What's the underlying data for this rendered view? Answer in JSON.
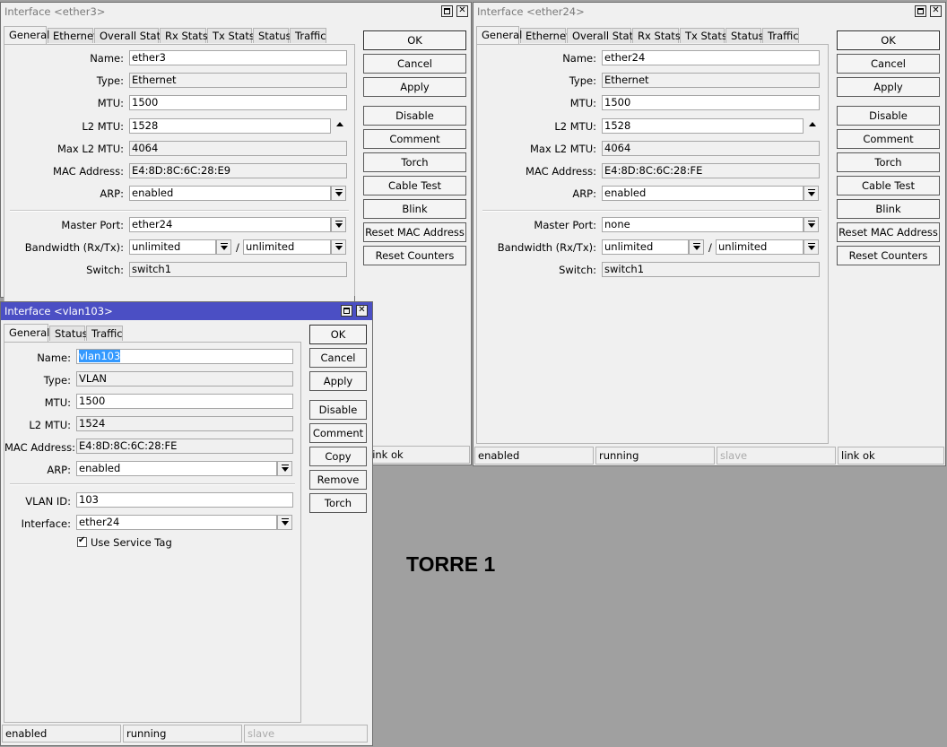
{
  "caption": "TORRE 1",
  "window_ether3": {
    "title": "Interface <ether3>",
    "tabs": [
      "General",
      "Ethernet",
      "Overall Stats",
      "Rx Stats",
      "Tx Stats",
      "Status",
      "Traffic"
    ],
    "fields": {
      "name_label": "Name:",
      "name": "ether3",
      "type_label": "Type:",
      "type": "Ethernet",
      "mtu_label": "MTU:",
      "mtu": "1500",
      "l2mtu_label": "L2 MTU:",
      "l2mtu": "1528",
      "maxl2mtu_label": "Max L2 MTU:",
      "maxl2mtu": "4064",
      "mac_label": "MAC Address:",
      "mac": "E4:8D:8C:6C:28:E9",
      "arp_label": "ARP:",
      "arp": "enabled",
      "master_label": "Master Port:",
      "master": "ether24",
      "bw_label": "Bandwidth (Rx/Tx):",
      "bw_rx": "unlimited",
      "bw_tx": "unlimited",
      "bw_sep": "/",
      "switch_label": "Switch:",
      "switch": "switch1"
    },
    "buttons": [
      "OK",
      "Cancel",
      "Apply",
      "Disable",
      "Comment",
      "Torch",
      "Cable Test",
      "Blink",
      "Reset MAC Address",
      "Reset Counters"
    ],
    "status": [
      "link ok"
    ]
  },
  "window_ether24": {
    "title": "Interface <ether24>",
    "tabs": [
      "General",
      "Ethernet",
      "Overall Stats",
      "Rx Stats",
      "Tx Stats",
      "Status",
      "Traffic"
    ],
    "fields": {
      "name_label": "Name:",
      "name": "ether24",
      "type_label": "Type:",
      "type": "Ethernet",
      "mtu_label": "MTU:",
      "mtu": "1500",
      "l2mtu_label": "L2 MTU:",
      "l2mtu": "1528",
      "maxl2mtu_label": "Max L2 MTU:",
      "maxl2mtu": "4064",
      "mac_label": "MAC Address:",
      "mac": "E4:8D:8C:6C:28:FE",
      "arp_label": "ARP:",
      "arp": "enabled",
      "master_label": "Master Port:",
      "master": "none",
      "bw_label": "Bandwidth (Rx/Tx):",
      "bw_rx": "unlimited",
      "bw_tx": "unlimited",
      "bw_sep": "/",
      "switch_label": "Switch:",
      "switch": "switch1"
    },
    "buttons": [
      "OK",
      "Cancel",
      "Apply",
      "Disable",
      "Comment",
      "Torch",
      "Cable Test",
      "Blink",
      "Reset MAC Address",
      "Reset Counters"
    ],
    "status": [
      "enabled",
      "running",
      "slave",
      "link ok"
    ]
  },
  "window_vlan103": {
    "title": "Interface <vlan103>",
    "tabs": [
      "General",
      "Status",
      "Traffic"
    ],
    "fields": {
      "name_label": "Name:",
      "name": "vlan103",
      "type_label": "Type:",
      "type": "VLAN",
      "mtu_label": "MTU:",
      "mtu": "1500",
      "l2mtu_label": "L2 MTU:",
      "l2mtu": "1524",
      "mac_label": "MAC Address:",
      "mac": "E4:8D:8C:6C:28:FE",
      "arp_label": "ARP:",
      "arp": "enabled",
      "vlanid_label": "VLAN ID:",
      "vlanid": "103",
      "iface_label": "Interface:",
      "iface": "ether24",
      "service_tag_label": "Use Service Tag"
    },
    "buttons": [
      "OK",
      "Cancel",
      "Apply",
      "Disable",
      "Comment",
      "Copy",
      "Remove",
      "Torch"
    ],
    "status": [
      "enabled",
      "running",
      "slave"
    ]
  }
}
